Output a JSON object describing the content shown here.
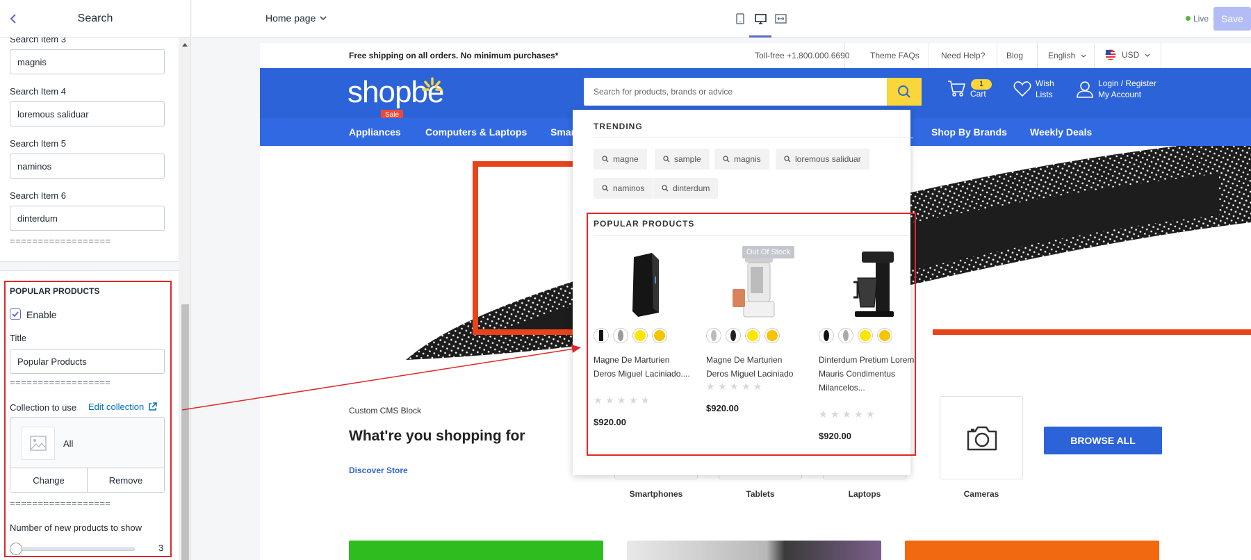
{
  "editor": {
    "title": "Search",
    "fields": [
      {
        "label": "Search Item 3",
        "value": "magnis"
      },
      {
        "label": "Search Item 4",
        "value": "loremous saliduar"
      },
      {
        "label": "Search Item 5",
        "value": "naminos"
      },
      {
        "label": "Search Item 6",
        "value": "dinterdum"
      }
    ],
    "separator": "==================",
    "popular": {
      "heading": "POPULAR PRODUCTS",
      "enable_label": "Enable",
      "enabled": true,
      "title_label": "Title",
      "title_value": "Popular Products",
      "collection_label": "Collection to use",
      "edit_collection": "Edit collection",
      "collection_name": "All",
      "change": "Change",
      "remove": "Remove",
      "count_label": "Number of new products to show",
      "count_value": "3"
    }
  },
  "topbar": {
    "page_select": "Home page",
    "live": "Live",
    "save": "Save"
  },
  "store": {
    "shipping": "Free shipping on all orders. No minimum purchases*",
    "tollfree": "Toll-free +1.800.000.6690",
    "faq": "Theme FAQs",
    "help": "Need Help?",
    "blog": "Blog",
    "language": "English",
    "currency": "USD",
    "logo": "shopbe",
    "sale_badge": "Sale",
    "search_placeholder": "Search for products, brands or advice",
    "cart_count": "1",
    "cart": "Cart",
    "wish1": "Wish",
    "wish2": "Lists",
    "login": "Login / Register",
    "account": "My Account",
    "categories": [
      "Appliances",
      "Computers & Laptops",
      "Smar",
      "Shop By Brands",
      "Weekly Deals"
    ],
    "cms_label": "Custom CMS Block",
    "cms_title": "What're you shopping for",
    "cms_link": "Discover Store",
    "tiles": [
      "Smartphones",
      "Tablets",
      "Laptops",
      "Cameras"
    ],
    "browse": "BROWSE ALL"
  },
  "dropdown": {
    "trending_head": "TRENDING",
    "trending": [
      "magne",
      "sample",
      "magnis",
      "loremous saliduar",
      "naminos",
      "dinterdum"
    ],
    "popular_head": "POPULAR PRODUCTS",
    "out_of_stock": "Out Of Stock",
    "products": [
      {
        "name": "Magne De Marturien Deros Miguel Laciniado....",
        "price": "$920.00"
      },
      {
        "name": "Magne De Marturien Deros Miguel Laciniado",
        "price": "$920.00"
      },
      {
        "name": "Dinterdum Pretium Lorem Mauris Condimentus Milancelos...",
        "price": "$920.00"
      }
    ]
  },
  "colors": {
    "brand_blue": "#2d63d8",
    "accent_yellow": "#f9d73a",
    "annotation_red": "#e02828"
  }
}
